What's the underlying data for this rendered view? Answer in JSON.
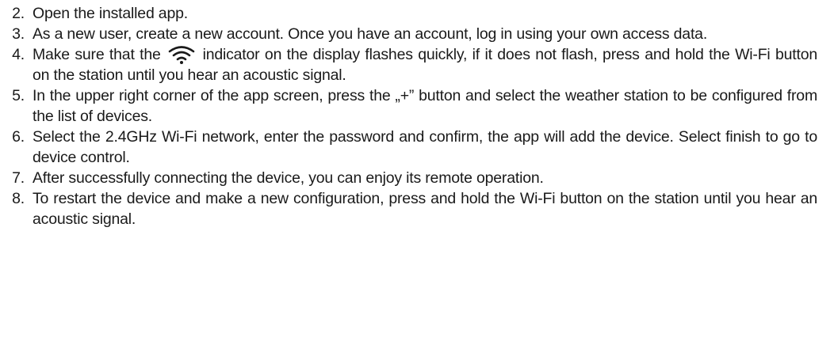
{
  "steps": [
    {
      "number": "2.",
      "text": "Open the installed app."
    },
    {
      "number": "3.",
      "text": "As a new user, create a new account. Once you have an account, log in using your own access data."
    },
    {
      "number": "4.",
      "text_before": "Make sure that the",
      "icon": "wifi-icon",
      "text_after": "indicator on the display flashes quickly, if it does not flash, press and hold the Wi-Fi button on the station until you hear an acoustic signal."
    },
    {
      "number": "5.",
      "text": "In the upper right corner of the app screen, press the „+” button and select the weather station to be configured from the list of devices."
    },
    {
      "number": "6.",
      "text": "Select the 2.4GHz Wi-Fi network, enter the password and confirm, the app will add the device. Select finish to go to device control."
    },
    {
      "number": "7.",
      "text": "After successfully connecting the device, you can enjoy its remote operation."
    },
    {
      "number": "8.",
      "text": "To restart the device and make a new configuration, press and hold the Wi-Fi button on the station until you hear an acoustic signal."
    }
  ]
}
